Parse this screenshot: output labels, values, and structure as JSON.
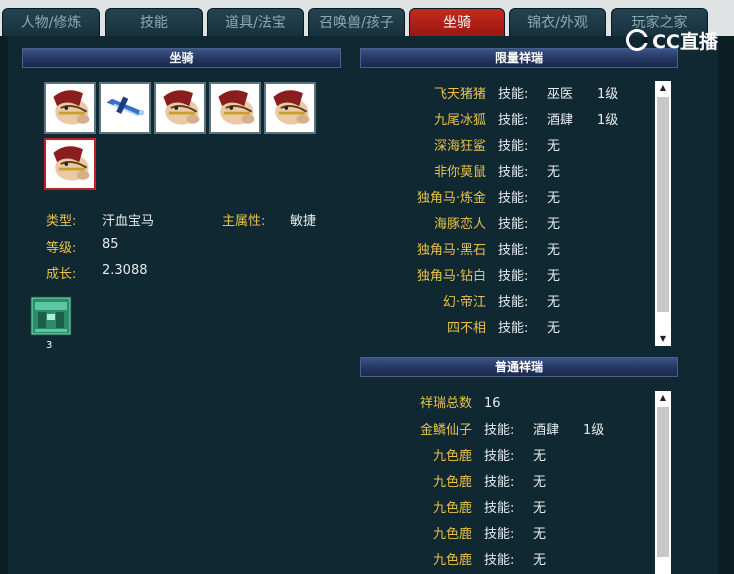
{
  "tabs": [
    {
      "label": "人物/修炼",
      "active": false
    },
    {
      "label": "技能",
      "active": false
    },
    {
      "label": "道具/法宝",
      "active": false
    },
    {
      "label": "召唤兽/孩子",
      "active": false
    },
    {
      "label": "坐骑",
      "active": true
    },
    {
      "label": "锦衣/外观",
      "active": false
    },
    {
      "label": "玩家之家",
      "active": false
    }
  ],
  "logo": {
    "text": "CC直播"
  },
  "mount_panel": {
    "title": "坐骑",
    "slots": [
      {
        "icon": "horse-mount-icon",
        "selected": false
      },
      {
        "icon": "blue-flying-sword-mount-icon",
        "selected": false
      },
      {
        "icon": "horse-mount-icon",
        "selected": false
      },
      {
        "icon": "horse-mount-icon",
        "selected": false
      },
      {
        "icon": "horse-mount-icon",
        "selected": false
      },
      {
        "icon": "horse-mount-icon",
        "selected": true
      }
    ],
    "type_label": "类型:",
    "type_value": "汗血宝马",
    "main_attr_label": "主属性:",
    "main_attr_value": "敏捷",
    "level_label": "等级:",
    "level_value": "85",
    "growth_label": "成长:",
    "growth_value": "2.3088",
    "item": {
      "icon": "green-jade-chest-icon",
      "count": "3"
    }
  },
  "limited_panel": {
    "title": "限量祥瑞",
    "rows": [
      {
        "name": "飞天猪猪",
        "skill_label": "技能:",
        "skill": "巫医",
        "level": "1级"
      },
      {
        "name": "九尾冰狐",
        "skill_label": "技能:",
        "skill": "酒肆",
        "level": "1级"
      },
      {
        "name": "深海狂鲨",
        "skill_label": "技能:",
        "skill": "无",
        "level": ""
      },
      {
        "name": "非你莫鼠",
        "skill_label": "技能:",
        "skill": "无",
        "level": ""
      },
      {
        "name": "独角马·炼金",
        "skill_label": "技能:",
        "skill": "无",
        "level": ""
      },
      {
        "name": "海豚恋人",
        "skill_label": "技能:",
        "skill": "无",
        "level": ""
      },
      {
        "name": "独角马·黑石",
        "skill_label": "技能:",
        "skill": "无",
        "level": ""
      },
      {
        "name": "独角马·钻白",
        "skill_label": "技能:",
        "skill": "无",
        "level": ""
      },
      {
        "name": "幻·帝江",
        "skill_label": "技能:",
        "skill": "无",
        "level": ""
      },
      {
        "name": "四不相",
        "skill_label": "技能:",
        "skill": "无",
        "level": ""
      }
    ]
  },
  "normal_panel": {
    "title": "普通祥瑞",
    "total_label": "祥瑞总数",
    "total_value": "16",
    "rows": [
      {
        "name": "金鳞仙子",
        "skill_label": "技能:",
        "skill": "酒肆",
        "level": "1级"
      },
      {
        "name": "九色鹿",
        "skill_label": "技能:",
        "skill": "无",
        "level": ""
      },
      {
        "name": "九色鹿",
        "skill_label": "技能:",
        "skill": "无",
        "level": ""
      },
      {
        "name": "九色鹿",
        "skill_label": "技能:",
        "skill": "无",
        "level": ""
      },
      {
        "name": "九色鹿",
        "skill_label": "技能:",
        "skill": "无",
        "level": ""
      },
      {
        "name": "九色鹿",
        "skill_label": "技能:",
        "skill": "无",
        "level": ""
      }
    ]
  },
  "colors": {
    "accent_red": "#b0201a",
    "label_gold": "#e8c24a",
    "panel_bg": "#102832"
  }
}
